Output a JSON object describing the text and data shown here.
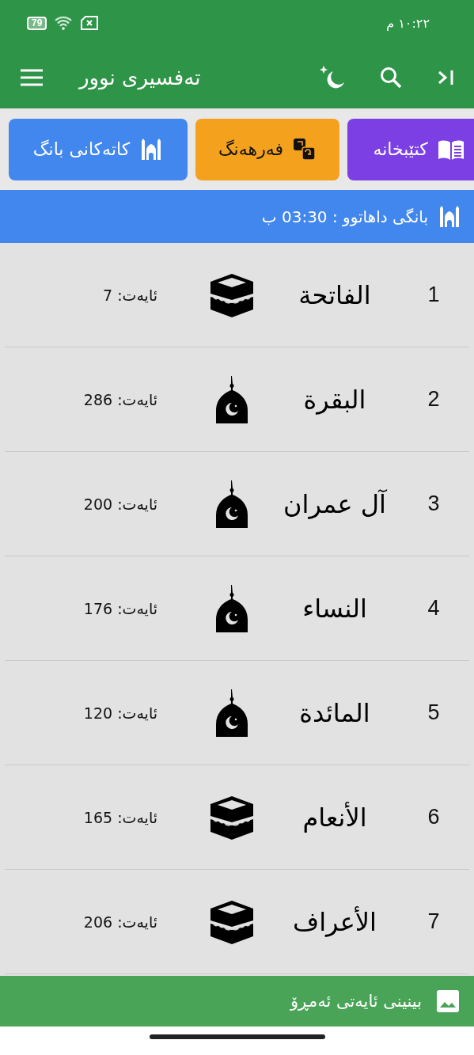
{
  "status_bar": {
    "time": "١٠:٢٢ م",
    "battery": "79"
  },
  "app_bar": {
    "title": "تەفسیری نوور"
  },
  "shortcuts": [
    {
      "label": "كتێبخانه",
      "kind": "library",
      "color": "#7b3fe4"
    },
    {
      "label": "فەرهەنگ",
      "kind": "dictionary",
      "color": "#f4a11d"
    },
    {
      "label": "کاتەکانی بانگ",
      "kind": "prayer",
      "color": "#4287ee"
    }
  ],
  "next_prayer": {
    "text": "بانگی داهاتوو : 03:30 ب"
  },
  "surahs": [
    {
      "number": "1",
      "name": "الفاتحة",
      "kind": "meccan",
      "ayahs": "ئایەت: 7"
    },
    {
      "number": "2",
      "name": "البقرة",
      "kind": "medinan",
      "ayahs": "ئایەت: 286"
    },
    {
      "number": "3",
      "name": "آل عمران",
      "kind": "medinan",
      "ayahs": "ئایەت: 200"
    },
    {
      "number": "4",
      "name": "النساء",
      "kind": "medinan",
      "ayahs": "ئایەت: 176"
    },
    {
      "number": "5",
      "name": "المائدة",
      "kind": "medinan",
      "ayahs": "ئایەت: 120"
    },
    {
      "number": "6",
      "name": "الأنعام",
      "kind": "meccan",
      "ayahs": "ئایەت: 165"
    },
    {
      "number": "7",
      "name": "الأعراف",
      "kind": "meccan",
      "ayahs": "ئایەت: 206"
    }
  ],
  "daily_verse": {
    "label": "بینینی ئایەتی ئەمڕۆ"
  }
}
